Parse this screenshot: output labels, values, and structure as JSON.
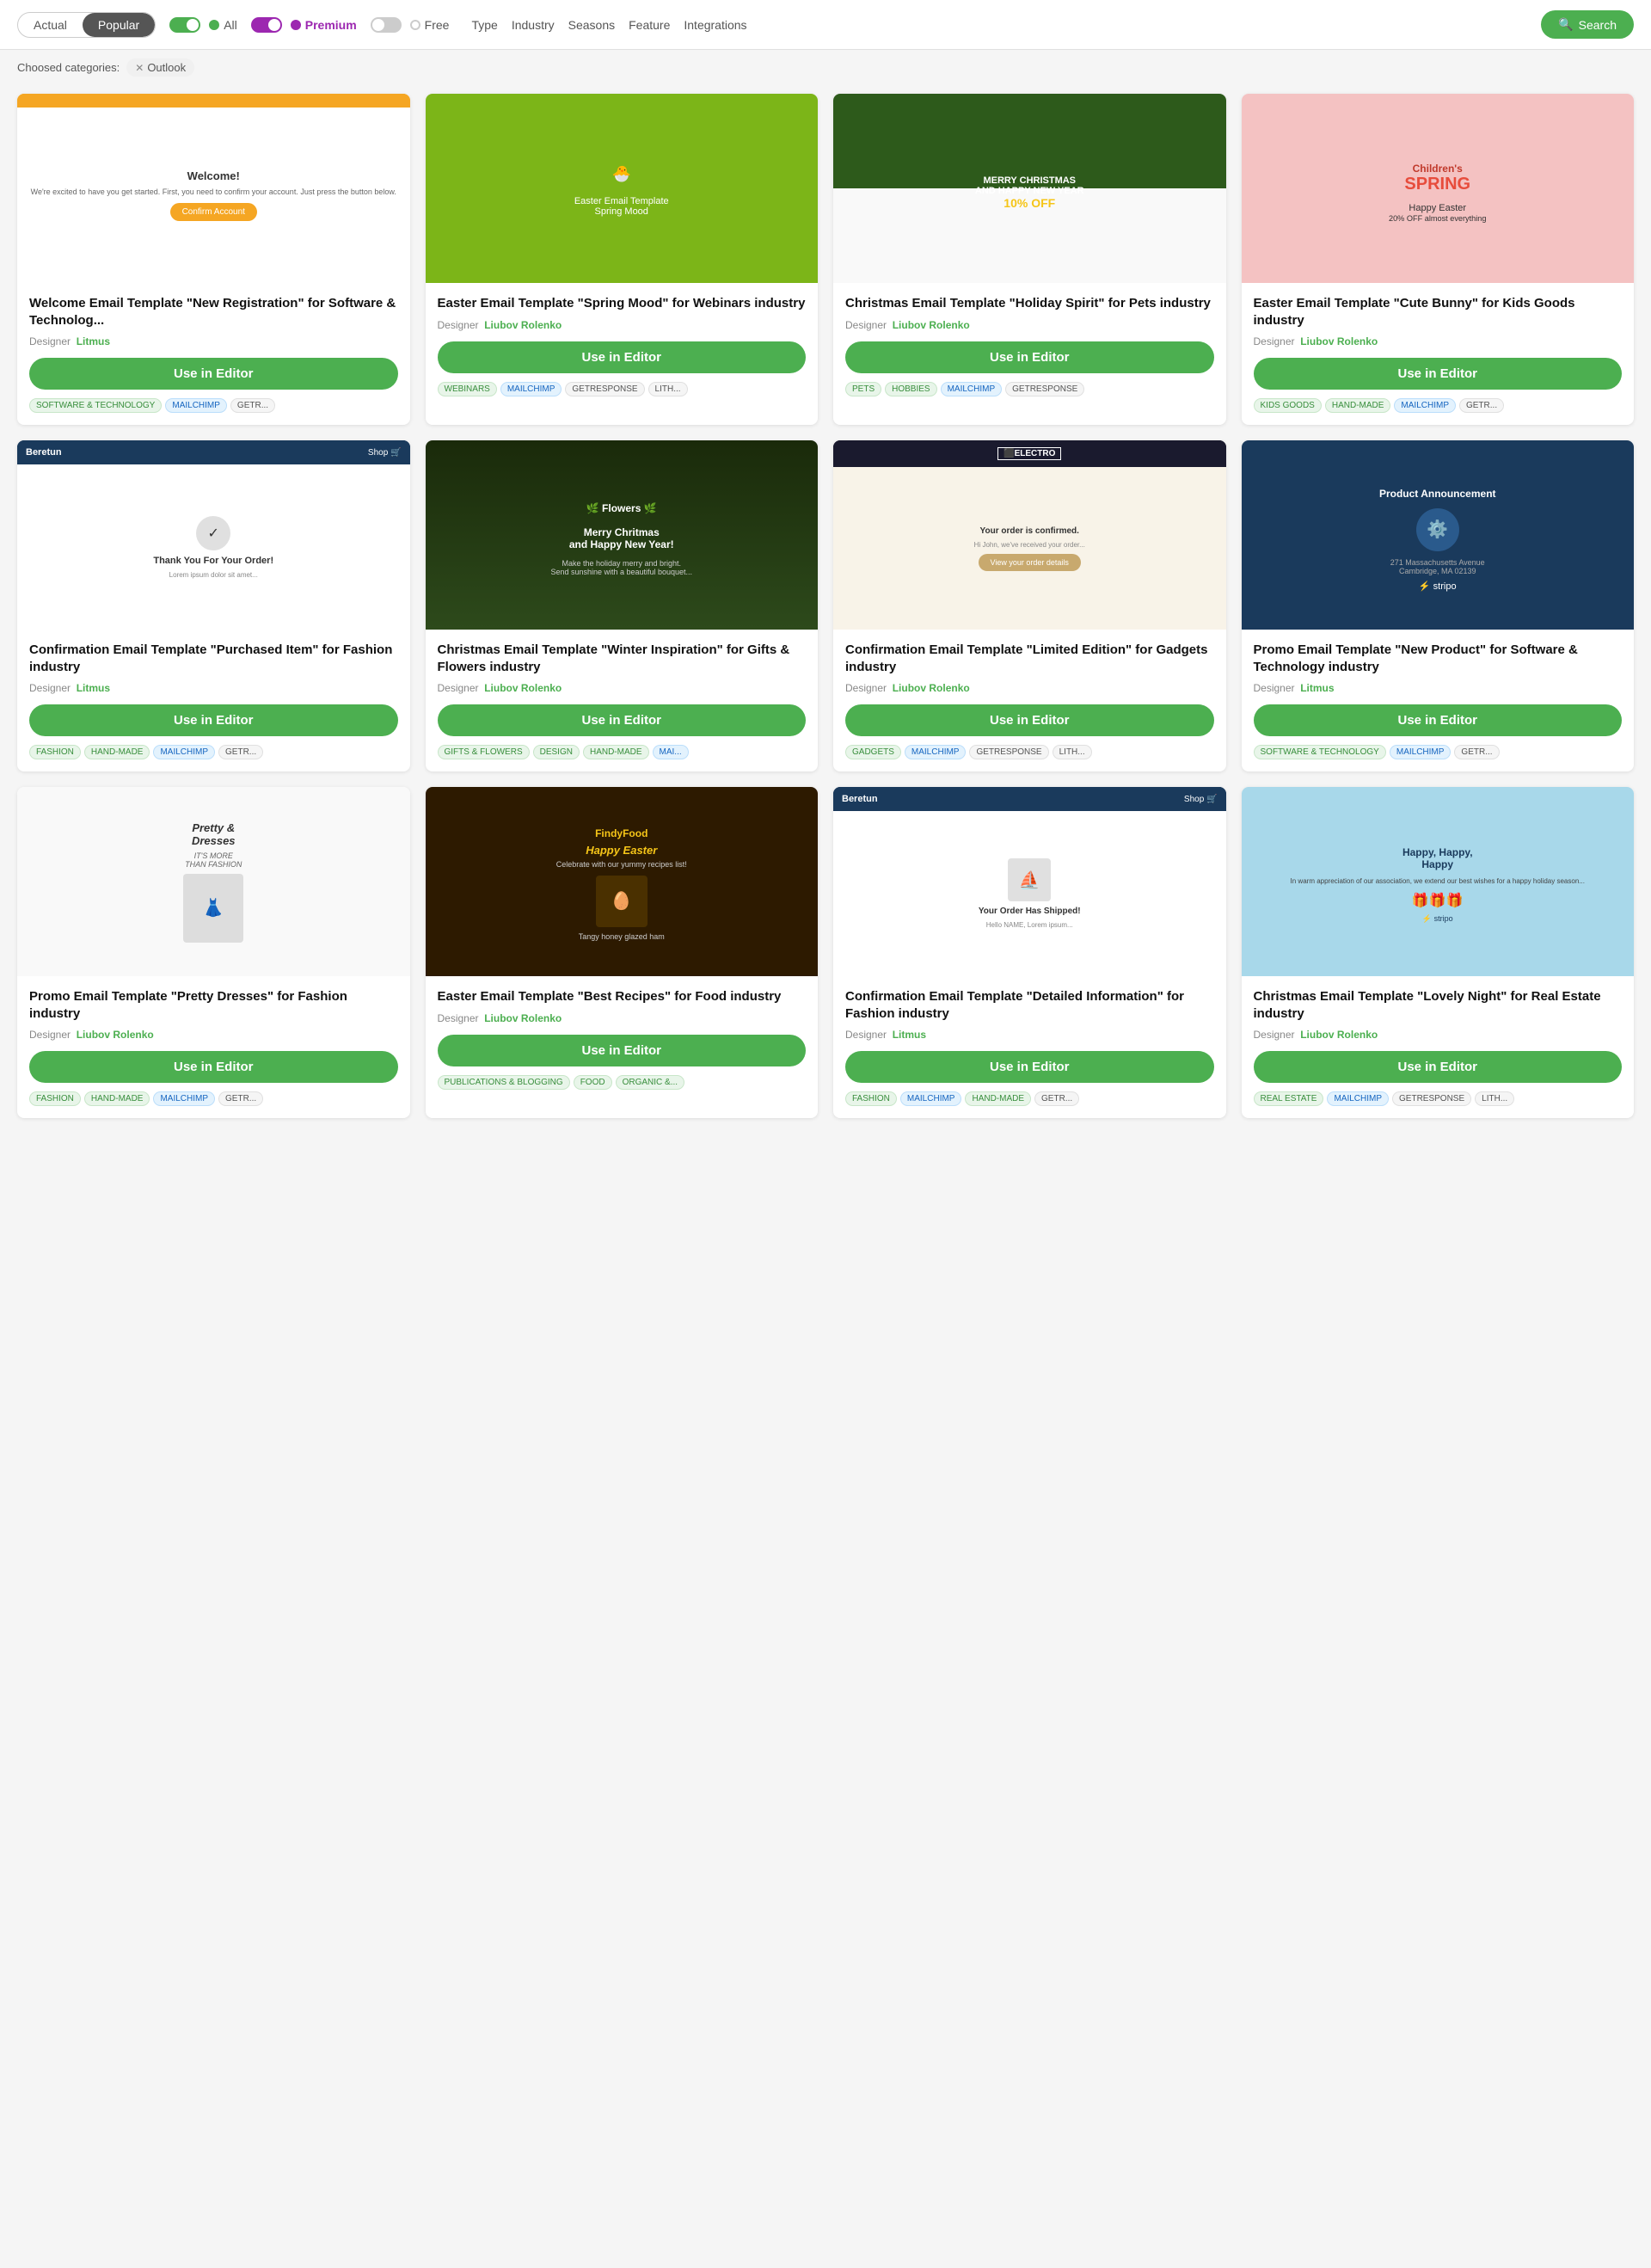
{
  "header": {
    "tabs": [
      {
        "label": "Actual",
        "active": false
      },
      {
        "label": "Popular",
        "active": true
      }
    ],
    "toggles": [
      {
        "label": "All",
        "dot_color": "#4caf50",
        "active": true
      },
      {
        "label": "Premium",
        "dot_color": "#9c27b0",
        "active": true
      },
      {
        "label": "Free",
        "dot_color": "#ccc",
        "active": false
      }
    ],
    "filter_links": [
      "Type",
      "Industry",
      "Seasons",
      "Feature",
      "Integrations"
    ],
    "search_label": "Search"
  },
  "category_bar": {
    "label": "Choosed categories:",
    "tags": [
      "Outlook"
    ]
  },
  "cards": [
    {
      "id": "card-1",
      "title": "Welcome Email Template \"New Registration\" for Software & Technolog...",
      "designer": "Litmus",
      "designer_link": true,
      "btn_label": "Use in Editor",
      "preview_color_top": "#f5a623",
      "preview_type": "welcome",
      "tags": [
        "SOFTWARE & TECHNOLOGY",
        "MAILCHIMP",
        "GETR..."
      ],
      "tag_colors": [
        "green",
        "blue",
        "gray"
      ]
    },
    {
      "id": "card-2",
      "title": "Easter Email Template \"Spring Mood\" for Webinars industry",
      "designer": "Liubov Rolenko",
      "designer_link": true,
      "btn_label": "Use in Editor",
      "preview_color_top": "#7cb518",
      "preview_type": "easter-spring",
      "tags": [
        "WEBINARS",
        "MAILCHIMP",
        "GETRESPONSE",
        "LITH..."
      ],
      "tag_colors": [
        "green",
        "blue",
        "gray",
        "gray"
      ]
    },
    {
      "id": "card-3",
      "title": "Christmas Email Template \"Holiday Spirit\" for Pets industry",
      "designer": "Liubov Rolenko",
      "designer_link": true,
      "btn_label": "Use in Editor",
      "preview_color_top": "#2d5a1b",
      "preview_type": "christmas-holiday",
      "tags": [
        "PETS",
        "HOBBIES",
        "MAILCHIMP",
        "GETRESPONSE"
      ],
      "tag_colors": [
        "green",
        "green",
        "blue",
        "gray"
      ]
    },
    {
      "id": "card-4",
      "title": "Easter Email Template \"Cute Bunny\" for Kids Goods industry",
      "designer": "Liubov Rolenko",
      "designer_link": true,
      "btn_label": "Use in Editor",
      "preview_color_top": "#f4c2c2",
      "preview_type": "easter-kids",
      "tags": [
        "KIDS GOODS",
        "HAND-MADE",
        "MAILCHIMP",
        "GETR..."
      ],
      "tag_colors": [
        "green",
        "green",
        "blue",
        "gray"
      ]
    },
    {
      "id": "card-5",
      "title": "Confirmation Email Template \"Purchased Item\" for Fashion industry",
      "designer": "Litmus",
      "designer_link": true,
      "btn_label": "Use in Editor",
      "preview_color_top": "#1a3a5c",
      "preview_type": "beretun-fashion",
      "tags": [
        "FASHION",
        "HAND-MADE",
        "MAILCHIMP",
        "GETR..."
      ],
      "tag_colors": [
        "green",
        "green",
        "blue",
        "gray"
      ]
    },
    {
      "id": "card-6",
      "title": "Christmas Email Template \"Winter Inspiration\" for Gifts & Flowers industry",
      "designer": "Liubov Rolenko",
      "designer_link": true,
      "btn_label": "Use in Editor",
      "preview_color_top": "#2d5a1b",
      "preview_type": "christmas-winter",
      "tags": [
        "GIFTS & FLOWERS",
        "DESIGN",
        "HAND-MADE",
        "MAI..."
      ],
      "tag_colors": [
        "green",
        "green",
        "green",
        "blue"
      ]
    },
    {
      "id": "card-7",
      "title": "Confirmation Email Template \"Limited Edition\" for Gadgets industry",
      "designer": "Liubov Rolenko",
      "designer_link": true,
      "btn_label": "Use in Editor",
      "preview_color_top": "#1a1a2e",
      "preview_type": "confirmation-gadgets",
      "tags": [
        "GADGETS",
        "MAILCHIMP",
        "GETRESPONSE",
        "LITH..."
      ],
      "tag_colors": [
        "green",
        "blue",
        "gray",
        "gray"
      ]
    },
    {
      "id": "card-8",
      "title": "Promo Email Template \"New Product\" for Software & Technology industry",
      "designer": "Litmus",
      "designer_link": true,
      "btn_label": "Use in Editor",
      "preview_color_top": "#1a3a5c",
      "preview_type": "promo-software",
      "tags": [
        "SOFTWARE & TECHNOLOGY",
        "MAILCHIMP",
        "GETR..."
      ],
      "tag_colors": [
        "green",
        "blue",
        "gray"
      ]
    },
    {
      "id": "card-9",
      "title": "Promo Email Template \"Pretty Dresses\" for Fashion industry",
      "designer": "Liubov Rolenko",
      "designer_link": true,
      "btn_label": "Use in Editor",
      "preview_color_top": "#f9f9f9",
      "preview_type": "promo-pretty",
      "tags": [
        "FASHION",
        "HAND-MADE",
        "MAILCHIMP",
        "GETR..."
      ],
      "tag_colors": [
        "green",
        "green",
        "blue",
        "gray"
      ]
    },
    {
      "id": "card-10",
      "title": "Easter Email Template \"Best Recipes\" for Food industry",
      "designer": "Liubov Rolenko",
      "designer_link": true,
      "btn_label": "Use in Editor",
      "preview_color_top": "#2d1a00",
      "preview_type": "easter-food",
      "tags": [
        "PUBLICATIONS & BLOGGING",
        "FOOD",
        "ORGANIC &..."
      ],
      "tag_colors": [
        "green",
        "green",
        "green"
      ]
    },
    {
      "id": "card-11",
      "title": "Confirmation Email Template \"Detailed Information\" for Fashion industry",
      "designer": "Litmus",
      "designer_link": true,
      "btn_label": "Use in Editor",
      "preview_color_top": "#1a3a5c",
      "preview_type": "confirmation-fashion",
      "tags": [
        "FASHION",
        "MAILCHIMP",
        "HAND-MADE",
        "GETR..."
      ],
      "tag_colors": [
        "green",
        "blue",
        "green",
        "gray"
      ]
    },
    {
      "id": "card-12",
      "title": "Christmas Email Template \"Lovely Night\" for Real Estate industry",
      "designer": "Liubov Rolenko",
      "designer_link": true,
      "btn_label": "Use in Editor",
      "preview_color_top": "#a8d8ea",
      "preview_type": "christmas-real",
      "tags": [
        "REAL ESTATE",
        "MAILCHIMP",
        "GETRESPONSE",
        "LITH..."
      ],
      "tag_colors": [
        "green",
        "blue",
        "gray",
        "gray"
      ]
    }
  ]
}
